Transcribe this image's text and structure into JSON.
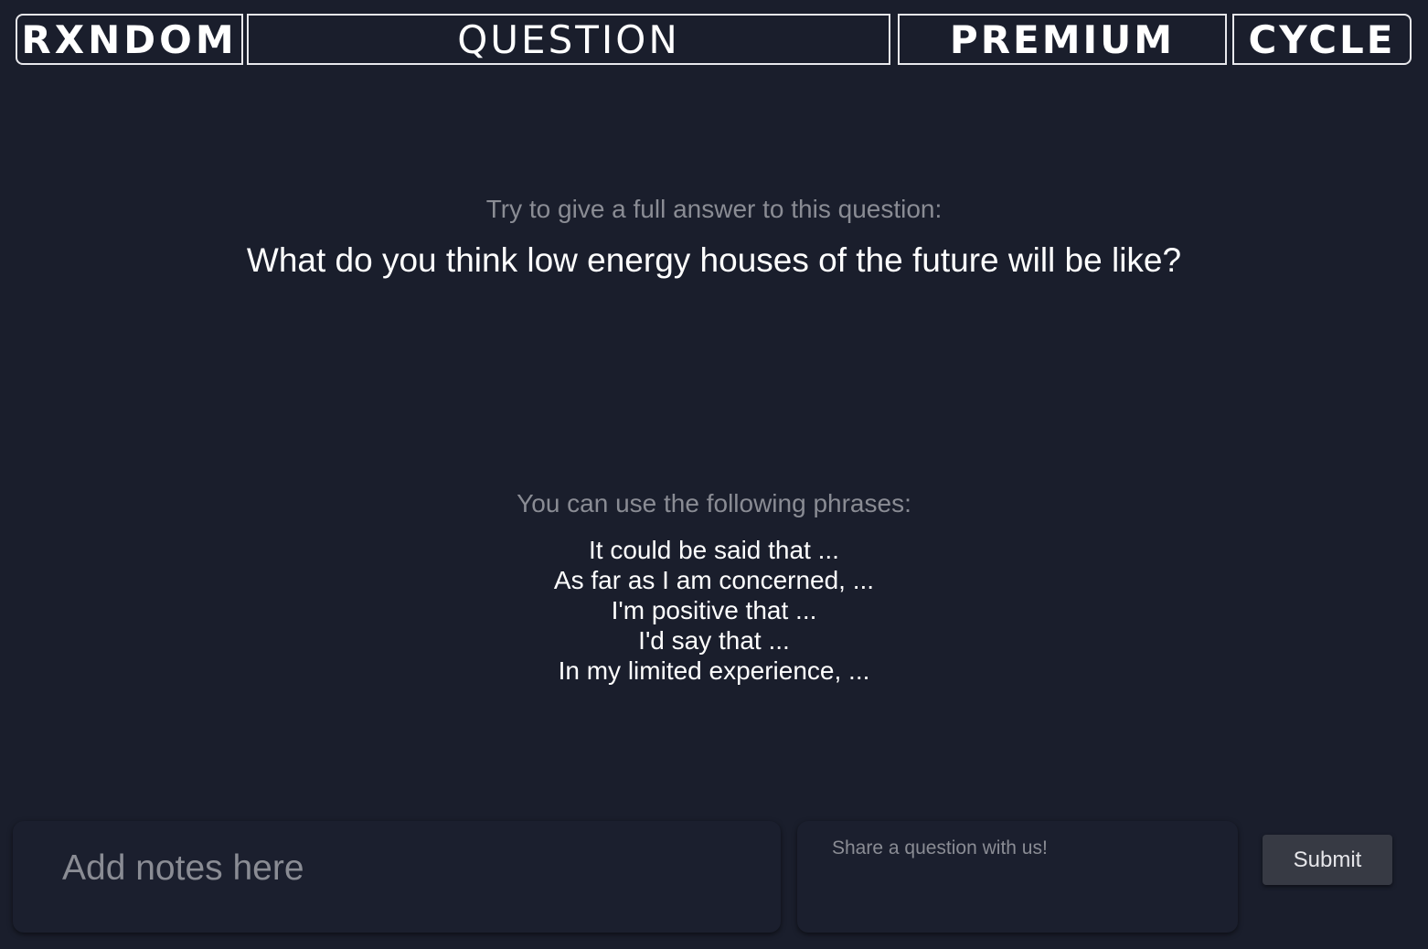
{
  "header": {
    "logo_word_1": "RXNDOM",
    "logo_word_2": "QUESTION",
    "logo_word_3": "PREMIUM",
    "logo_word_4": "CYCLE"
  },
  "prompt": {
    "instruction": "Try to give a full answer to this question:",
    "question": "What do you think low energy houses of the future will be like?"
  },
  "phrases": {
    "intro": "You can use the following phrases:",
    "items": [
      "It could be said that ...",
      "As far as I am concerned, ...",
      "I'm positive that ...",
      "I'd say that ...",
      "In my limited experience, ..."
    ]
  },
  "notes": {
    "placeholder": "Add notes here"
  },
  "share": {
    "placeholder": "Share a question with us!",
    "submit_label": "Submit"
  },
  "colors": {
    "background": "#1a1e2c",
    "muted_text": "#8a8c94",
    "button_bg": "#373a44"
  }
}
